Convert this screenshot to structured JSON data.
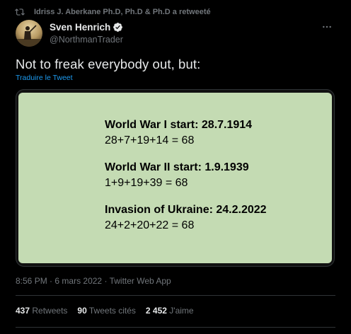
{
  "retweet": {
    "icon": "retweet-icon",
    "text": "Idriss J. Aberkane Ph.D, Ph.D & Ph.D a retweeté"
  },
  "author": {
    "display_name": "Sven Henrich",
    "handle": "@NorthmanTrader",
    "verified_icon": "verified-badge-icon"
  },
  "more_icon": "more-dots-icon",
  "tweet": {
    "text": "Not to freak everybody out, but:",
    "translate_label": "Traduire le Tweet"
  },
  "media": {
    "background_color": "#c4dbb3",
    "blocks": [
      {
        "title": "World War I start: 28.7.1914",
        "sum": "28+7+19+14 = 68"
      },
      {
        "title": "World War II start: 1.9.1939",
        "sum": "1+9+19+39 = 68"
      },
      {
        "title": "Invasion of Ukraine: 24.2.2022",
        "sum": "24+2+20+22 = 68"
      }
    ]
  },
  "meta": {
    "time": "8:56 PM",
    "separator": "·",
    "date": "6 mars 2022",
    "app": "Twitter Web App"
  },
  "stats": [
    {
      "count": "437",
      "label": "Retweets"
    },
    {
      "count": "90",
      "label": "Tweets cités"
    },
    {
      "count": "2 452",
      "label": "J'aime"
    }
  ],
  "colors": {
    "background": "#000000",
    "text_primary": "#e7e9ea",
    "text_secondary": "#71767b",
    "link": "#1d9bf0",
    "divider": "#2f3336"
  }
}
